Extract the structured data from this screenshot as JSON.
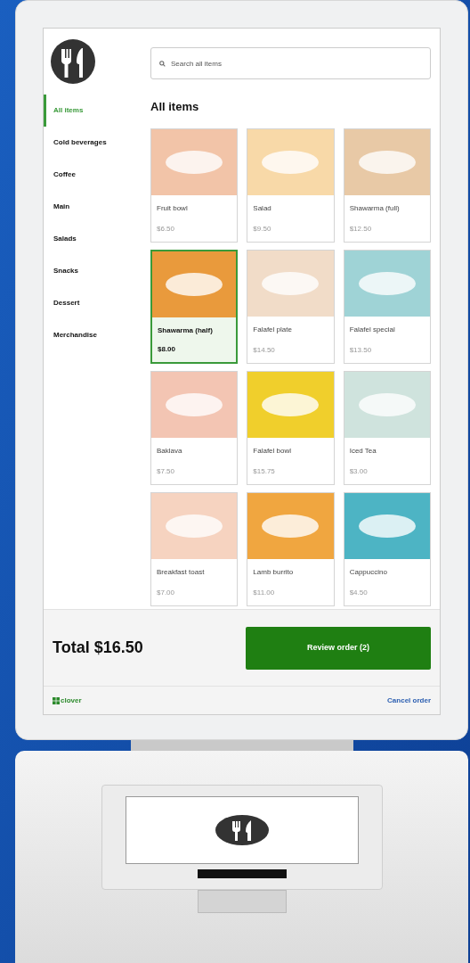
{
  "sidebar": {
    "items": [
      {
        "label": "All items",
        "selected": true
      },
      {
        "label": "Cold beverages",
        "selected": false
      },
      {
        "label": "Coffee",
        "selected": false
      },
      {
        "label": "Main",
        "selected": false
      },
      {
        "label": "Salads",
        "selected": false
      },
      {
        "label": "Snacks",
        "selected": false
      },
      {
        "label": "Dessert",
        "selected": false
      },
      {
        "label": "Merchandise",
        "selected": false
      }
    ]
  },
  "search": {
    "placeholder": "Search all items"
  },
  "heading": "All items",
  "items": [
    {
      "name": "Fruit bowl",
      "price": "$6.50",
      "selected": false
    },
    {
      "name": "Salad",
      "price": "$9.50",
      "selected": false
    },
    {
      "name": "Shawarma (full)",
      "price": "$12.50",
      "selected": false
    },
    {
      "name": "Shawarma (half)",
      "price": "$8.00",
      "selected": true
    },
    {
      "name": "Falafel plate",
      "price": "$14.50",
      "selected": false
    },
    {
      "name": "Falafel special",
      "price": "$13.50",
      "selected": false
    },
    {
      "name": "Baklava",
      "price": "$7.50",
      "selected": false
    },
    {
      "name": "Falafel bowl",
      "price": "$15.75",
      "selected": false
    },
    {
      "name": "Iced Tea",
      "price": "$3.00",
      "selected": false
    },
    {
      "name": "Breakfast toast",
      "price": "$7.00",
      "selected": false
    },
    {
      "name": "Lamb burrito",
      "price": "$11.00",
      "selected": false
    },
    {
      "name": "Cappuccino",
      "price": "$4.50",
      "selected": false
    }
  ],
  "footer": {
    "total": "Total $16.50",
    "review_button": "Review order (2)"
  },
  "bottom_bar": {
    "brand": "clover",
    "cancel": "Cancel order"
  }
}
